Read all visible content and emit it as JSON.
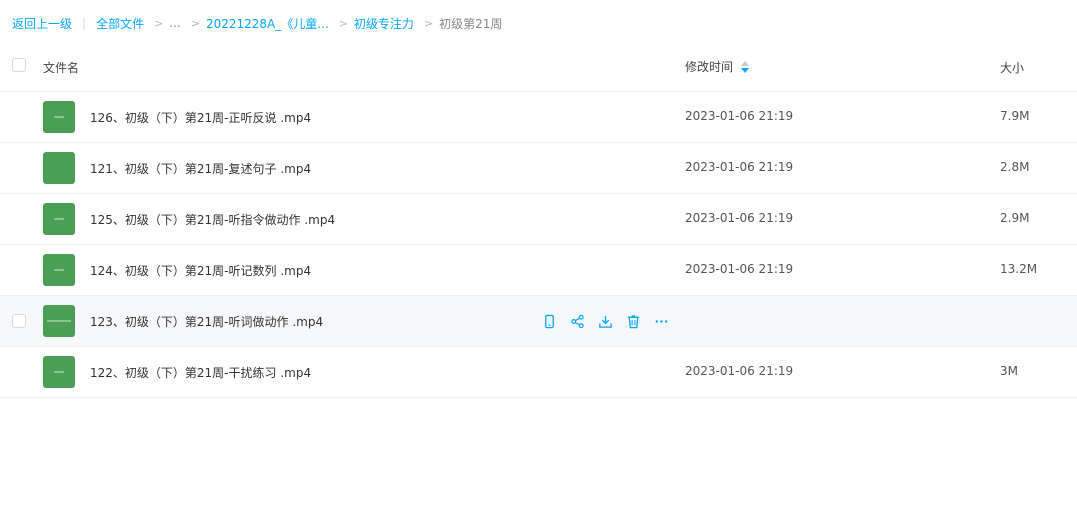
{
  "breadcrumb": {
    "back": "返回上一级",
    "all_files": "全部文件",
    "ellipsis": "...",
    "folder1": "20221228A_《儿童...",
    "folder2": "初级专注力",
    "current": "初级第21周"
  },
  "columns": {
    "name": "文件名",
    "time": "修改时间",
    "size": "大小"
  },
  "files": [
    {
      "name": "126、初级（下）第21周-正听反说 .mp4",
      "time": "2023-01-06 21:19",
      "size": "7.9M"
    },
    {
      "name": "121、初级（下）第21周-复述句子 .mp4",
      "time": "2023-01-06 21:19",
      "size": "2.8M"
    },
    {
      "name": "125、初级（下）第21周-听指令做动作 .mp4",
      "time": "2023-01-06 21:19",
      "size": "2.9M"
    },
    {
      "name": "124、初级（下）第21周-听记数列 .mp4",
      "time": "2023-01-06 21:19",
      "size": "13.2M"
    },
    {
      "name": "123、初级（下）第21周-听词做动作 .mp4",
      "time": "",
      "size": ""
    },
    {
      "name": "122、初级（下）第21周-干扰练习 .mp4",
      "time": "2023-01-06 21:19",
      "size": "3M"
    }
  ],
  "colors": {
    "accent": "#06a7ff",
    "thumbnail": "#4a9e55",
    "hover_row": "#f7f8fa"
  },
  "row_actions_icons": [
    "phone-icon",
    "share-icon",
    "download-icon",
    "trash-icon",
    "more-icon"
  ]
}
